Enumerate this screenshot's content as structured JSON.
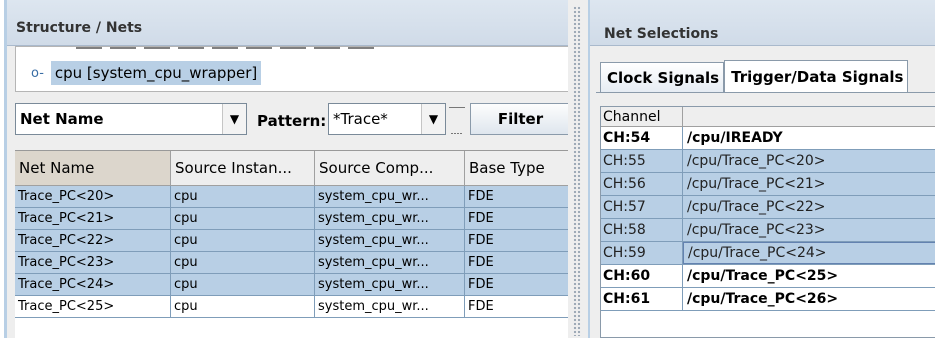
{
  "left": {
    "title": "Structure / Nets",
    "tree_node": "cpu [system_cpu_wrapper]",
    "filter": {
      "field_value": "Net Name",
      "pattern_label": "Pattern:",
      "pattern_value": "*Trace*",
      "filter_button": "Filter"
    },
    "columns": [
      "Net Name",
      "Source Instan...",
      "Source Comp...",
      "Base Type"
    ],
    "rows": [
      {
        "net": "Trace_PC<20>",
        "inst": "cpu",
        "comp": "system_cpu_wr...",
        "type": "FDE",
        "selected": false
      },
      {
        "net": "Trace_PC<21>",
        "inst": "cpu",
        "comp": "system_cpu_wr...",
        "type": "FDE",
        "selected": false
      },
      {
        "net": "Trace_PC<22>",
        "inst": "cpu",
        "comp": "system_cpu_wr...",
        "type": "FDE",
        "selected": false
      },
      {
        "net": "Trace_PC<23>",
        "inst": "cpu",
        "comp": "system_cpu_wr...",
        "type": "FDE",
        "selected": false
      },
      {
        "net": "Trace_PC<24>",
        "inst": "cpu",
        "comp": "system_cpu_wr...",
        "type": "FDE",
        "selected": false
      },
      {
        "net": "Trace_PC<25>",
        "inst": "cpu",
        "comp": "system_cpu_wr...",
        "type": "FDE",
        "selected": true
      }
    ]
  },
  "right": {
    "title": "Net Selections",
    "tabs": [
      "Clock Signals",
      "Trigger/Data Signals"
    ],
    "active_tab": 1,
    "columns": [
      "Channel",
      ""
    ],
    "rows": [
      {
        "ch": "CH:54",
        "name": "/cpu/IREADY",
        "bold": true,
        "highlighted": false
      },
      {
        "ch": "CH:55",
        "name": "/cpu/Trace_PC<20>",
        "bold": false,
        "highlighted": true
      },
      {
        "ch": "CH:56",
        "name": "/cpu/Trace_PC<21>",
        "bold": false,
        "highlighted": true
      },
      {
        "ch": "CH:57",
        "name": "/cpu/Trace_PC<22>",
        "bold": false,
        "highlighted": true
      },
      {
        "ch": "CH:58",
        "name": "/cpu/Trace_PC<23>",
        "bold": false,
        "highlighted": true
      },
      {
        "ch": "CH:59",
        "name": "/cpu/Trace_PC<24>",
        "bold": false,
        "highlighted": true,
        "focus": true
      },
      {
        "ch": "CH:60",
        "name": "/cpu/Trace_PC<25>",
        "bold": true,
        "highlighted": false
      },
      {
        "ch": "CH:61",
        "name": "/cpu/Trace_PC<26>",
        "bold": true,
        "highlighted": false
      }
    ]
  },
  "colors": {
    "selection": "#b8cfe5",
    "grid": "#7f9db9",
    "header_bg": "#dde6f0"
  }
}
